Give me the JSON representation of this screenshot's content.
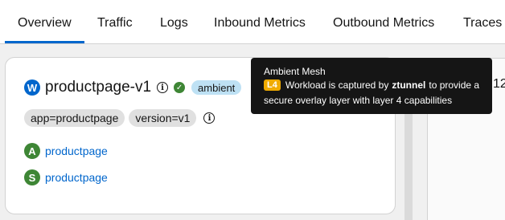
{
  "tabs": [
    {
      "label": "Overview",
      "active": true
    },
    {
      "label": "Traffic"
    },
    {
      "label": "Logs"
    },
    {
      "label": "Inbound Metrics"
    },
    {
      "label": "Outbound Metrics"
    },
    {
      "label": "Traces"
    }
  ],
  "workload": {
    "type_badge": "W",
    "name": "productpage-v1",
    "info_icon": "i",
    "status_icon": "✓",
    "mesh_badge": "ambient",
    "labels": [
      "app=productpage",
      "version=v1"
    ],
    "labels_info_icon": "i",
    "related": [
      {
        "badge": "A",
        "name": "productpage"
      },
      {
        "badge": "S",
        "name": "productpage"
      }
    ]
  },
  "tooltip": {
    "title": "Ambient Mesh",
    "badge": "L4",
    "line1_pre": "Workload is captured by",
    "line1_bold": "ztunnel",
    "line1_post": "to provide a",
    "line2": "secure overlay layer with layer 4 capabilities"
  },
  "right_panel": {
    "partial_text": "12"
  },
  "colors": {
    "accent": "#0066cc",
    "success": "#3e8635",
    "ambient_badge": "#bee1f4",
    "l4_badge": "#f0ab00",
    "tooltip_bg": "#151515"
  }
}
